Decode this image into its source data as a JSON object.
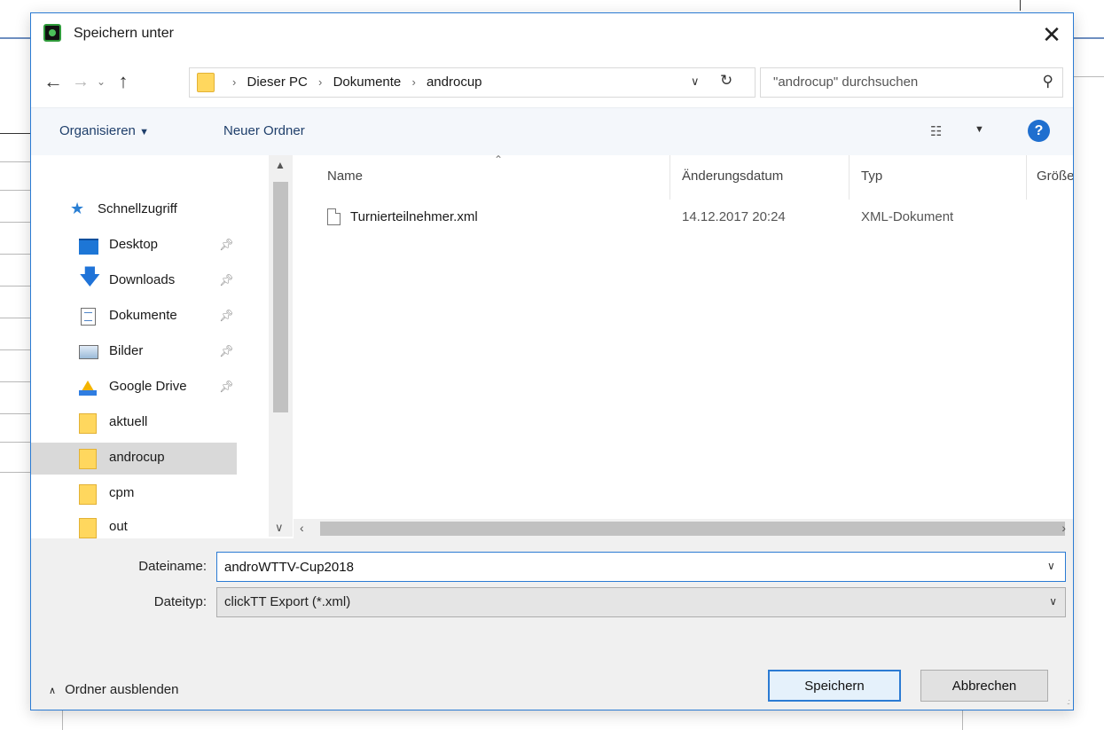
{
  "window": {
    "title": "Speichern unter"
  },
  "nav": {
    "breadcrumbs": [
      "Dieser PC",
      "Dokumente",
      "androcup"
    ],
    "search_placeholder": "\"androcup\" durchsuchen"
  },
  "toolbar": {
    "organize_label": "Organisieren",
    "new_folder_label": "Neuer Ordner"
  },
  "sidebar": {
    "quick_access": "Schnellzugriff",
    "items": [
      {
        "label": "Desktop",
        "pinned": true
      },
      {
        "label": "Downloads",
        "pinned": true
      },
      {
        "label": "Dokumente",
        "pinned": true
      },
      {
        "label": "Bilder",
        "pinned": true
      },
      {
        "label": "Google Drive",
        "pinned": true
      },
      {
        "label": "aktuell",
        "pinned": false
      },
      {
        "label": "androcup",
        "pinned": false,
        "selected": true
      },
      {
        "label": "cpm",
        "pinned": false
      },
      {
        "label": "out",
        "pinned": false
      }
    ]
  },
  "file_list": {
    "columns": [
      "Name",
      "Änderungsdatum",
      "Typ",
      "Größe"
    ],
    "files": [
      {
        "name": "Turnierteilnehmer.xml",
        "modified": "14.12.2017 20:24",
        "type": "XML-Dokument"
      }
    ]
  },
  "form": {
    "filename_label": "Dateiname:",
    "filename_value": "androWTTV-Cup2018",
    "filetype_label": "Dateityp:",
    "filetype_value": "clickTT Export (*.xml)"
  },
  "footer": {
    "hide_folders_label": "Ordner ausblenden",
    "save_label": "Speichern",
    "cancel_label": "Abbrechen"
  },
  "colors": {
    "accent": "#2b7bd3",
    "selection": "#d9d9d9",
    "toolbar_bg": "#f4f7fb",
    "bottom_bg": "#f0f0f0"
  }
}
